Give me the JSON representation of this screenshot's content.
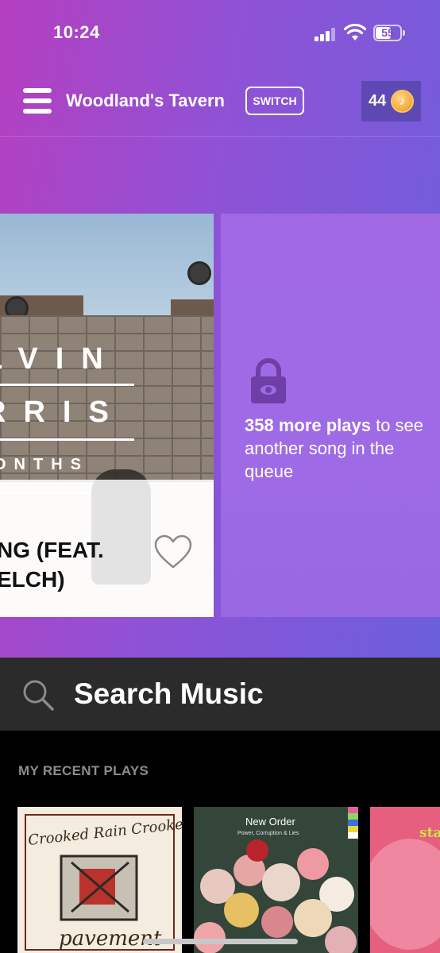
{
  "status_bar": {
    "time": "10:24",
    "battery": "55"
  },
  "header": {
    "venue_name": "Woodland's Tavern",
    "switch_label": "SWITCH",
    "coin_count": "44",
    "coin_glyph": "♪"
  },
  "now_playing": {
    "art_lines": [
      "LVIN",
      "RRIS",
      "ONTHS"
    ],
    "song_title_line1": "NG (FEAT.",
    "song_title_line2": "ELCH)"
  },
  "queue_lock": {
    "bold_text": "358 more plays",
    "rest_text": " to see another song in the queue"
  },
  "search": {
    "label": "Search Music"
  },
  "recent": {
    "title": "MY RECENT PLAYS",
    "items": [
      {
        "cover_text_top": "Crooked Rain Crooked Rain",
        "cover_text_bottom": "pavement"
      },
      {
        "cover_text_top": "New Order",
        "cover_text_sub": "Power, Corruption & Lies"
      },
      {
        "cover_text_top": "sta"
      }
    ]
  },
  "colors": {
    "gradient_start": "#b53fc0",
    "gradient_end": "#6b5fdc",
    "lock_card": "#9f6ae6",
    "search_bg": "#2b2b2b"
  }
}
